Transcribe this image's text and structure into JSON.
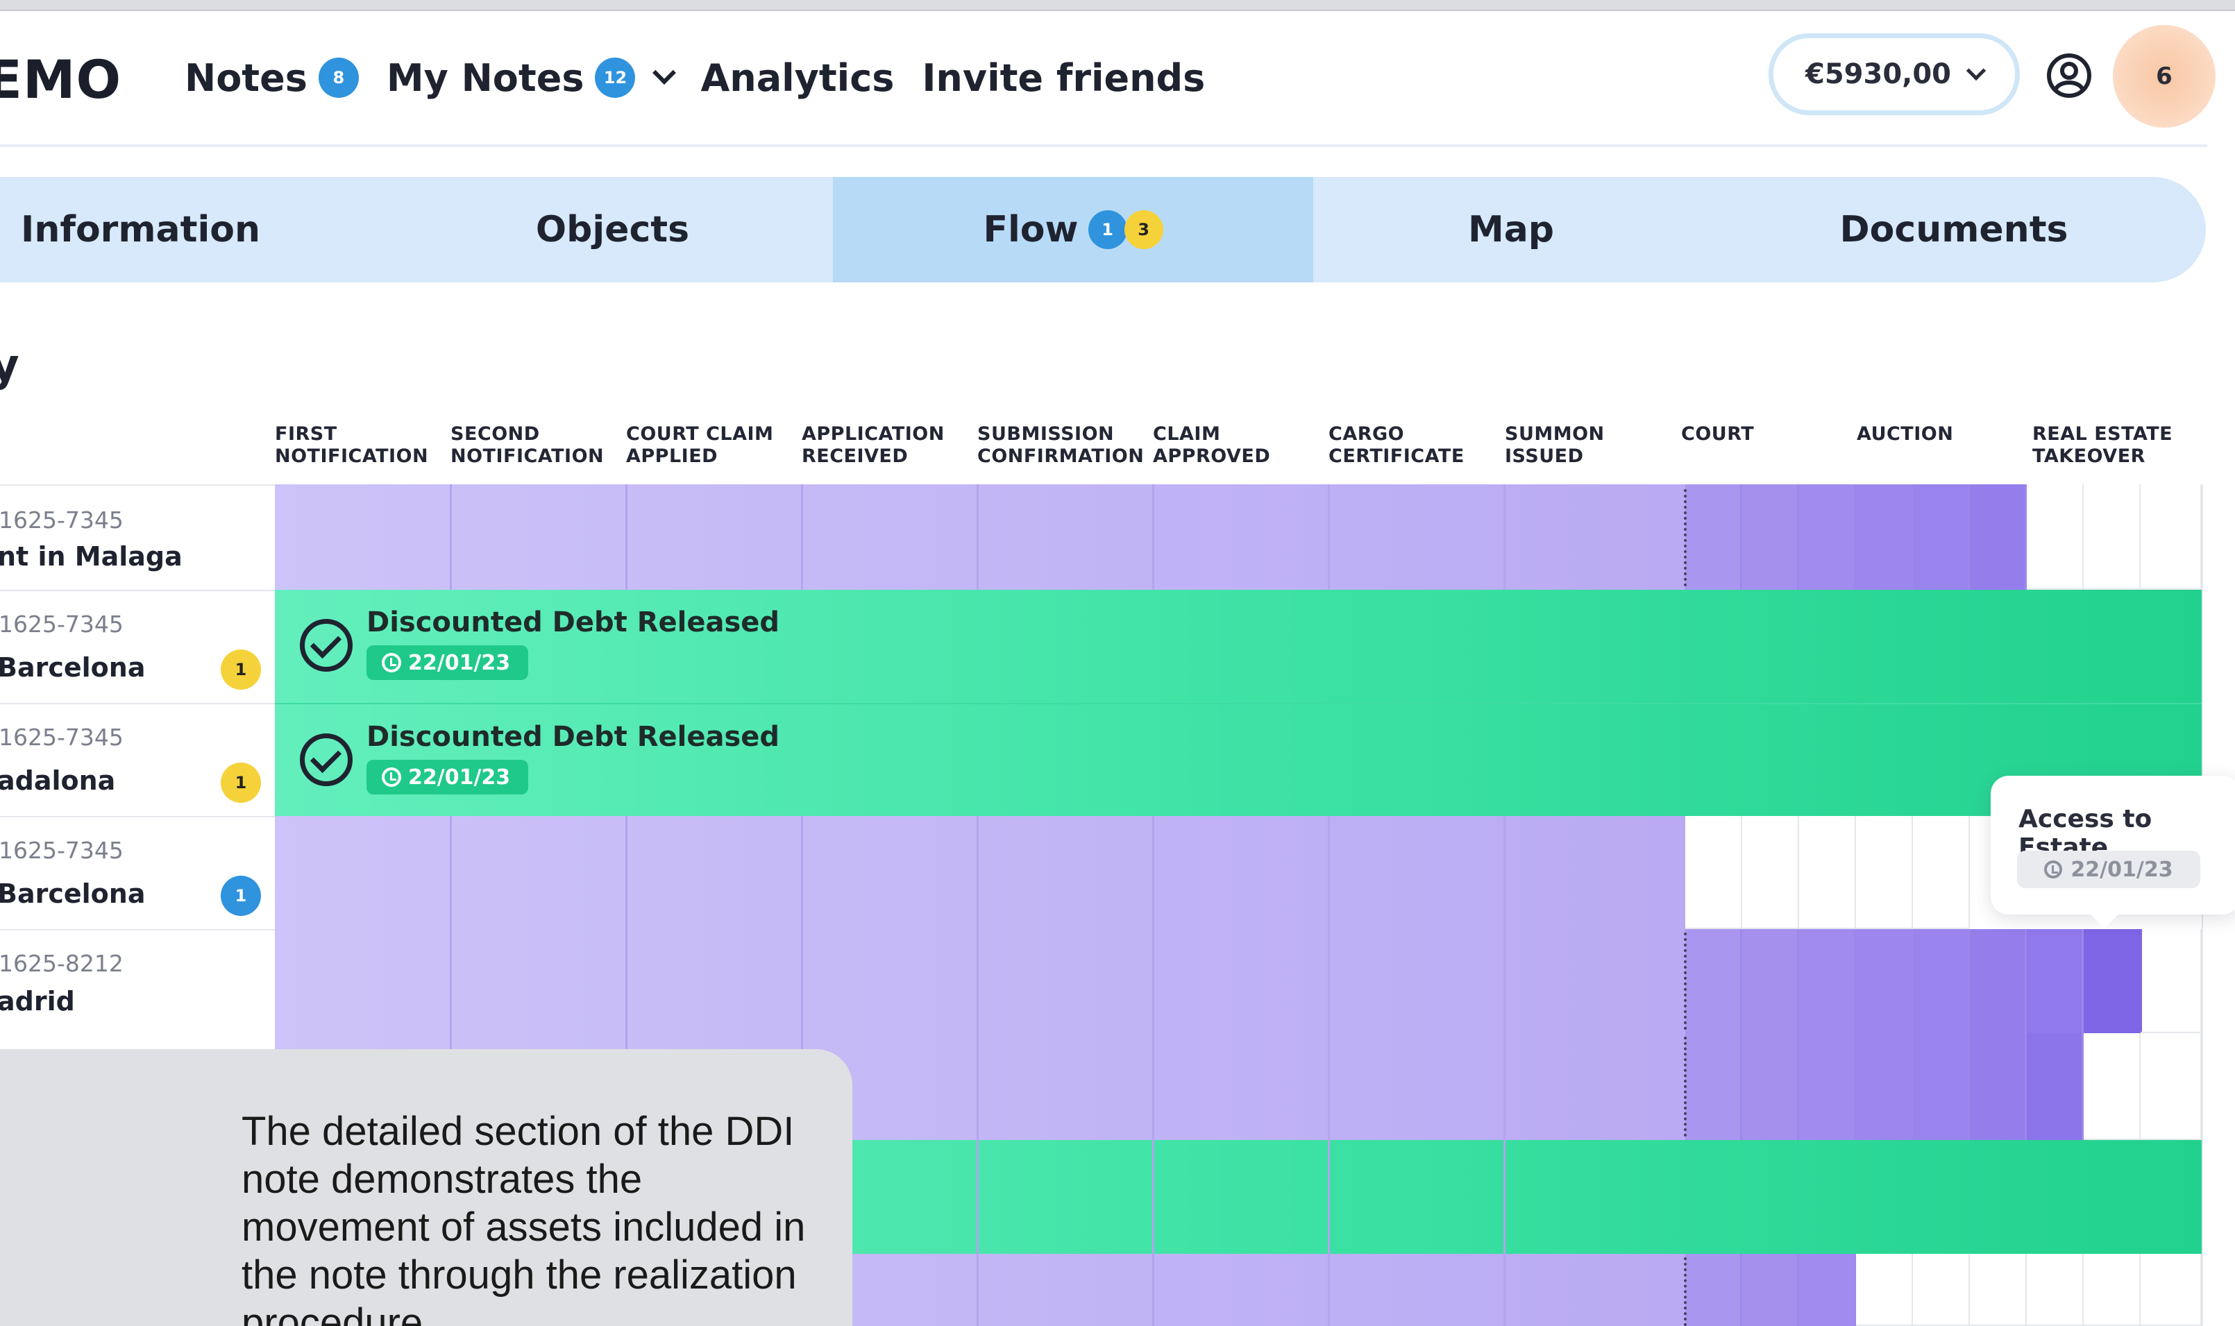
{
  "app": {
    "logo": "EMO"
  },
  "nav": [
    {
      "label": "Notes",
      "badge": "8"
    },
    {
      "label": "My Notes",
      "badge": "12"
    },
    {
      "label": "Analytics"
    },
    {
      "label": "Invite friends"
    }
  ],
  "balance": "€5930,00",
  "avatar_count": "6",
  "tabs": [
    {
      "label": "Information"
    },
    {
      "label": "Objects"
    },
    {
      "label": "Flow",
      "badge_blue": "1",
      "badge_yellow": "3",
      "active": true
    },
    {
      "label": "Map"
    },
    {
      "label": "Documents"
    }
  ],
  "section_heading": "y",
  "stages": [
    "FIRST NOTIFICATION",
    "SECOND NOTIFICATION",
    "COURT CLAIM APPLIED",
    "APPLICATION RECEIVED",
    "SUBMISSION CONFIRMATION",
    "CLAIM APPROVED",
    "CARGO CERTIFICATE",
    "SUMMON ISSUED",
    "COURT",
    "AUCTION",
    "REAL ESTATE TAKEOVER"
  ],
  "rows": [
    {
      "code": "1625-7345",
      "name": "nt in Malaga"
    },
    {
      "code": "1625-7345",
      "name": "Barcelona",
      "badge": "1",
      "badge_color": "yellow",
      "event": {
        "title": "Discounted Debt Released",
        "date": "22/01/23"
      }
    },
    {
      "code": "1625-7345",
      "name": "adalona",
      "badge": "1",
      "badge_color": "yellow",
      "event": {
        "title": "Discounted Debt Released",
        "date": "22/01/23"
      }
    },
    {
      "code": "1625-7345",
      "name": "Barcelona",
      "badge": "1",
      "badge_color": "blue"
    },
    {
      "code": "1625-8212",
      "name": "adrid"
    }
  ],
  "tooltip": {
    "title": "Access to Estate",
    "date": "22/01/23"
  },
  "caption": "The detailed section of the DDI note demonstrates the movement of assets included in the note through the realization procedure.",
  "colors": {
    "accent_blue": "#2f93de",
    "badge_yellow": "#f6d23a",
    "flow_purple": "#b9aaf3",
    "court_purple": "#a996ef",
    "success_green": "#3be1a3",
    "tab_bg": "#d7e9fa"
  }
}
